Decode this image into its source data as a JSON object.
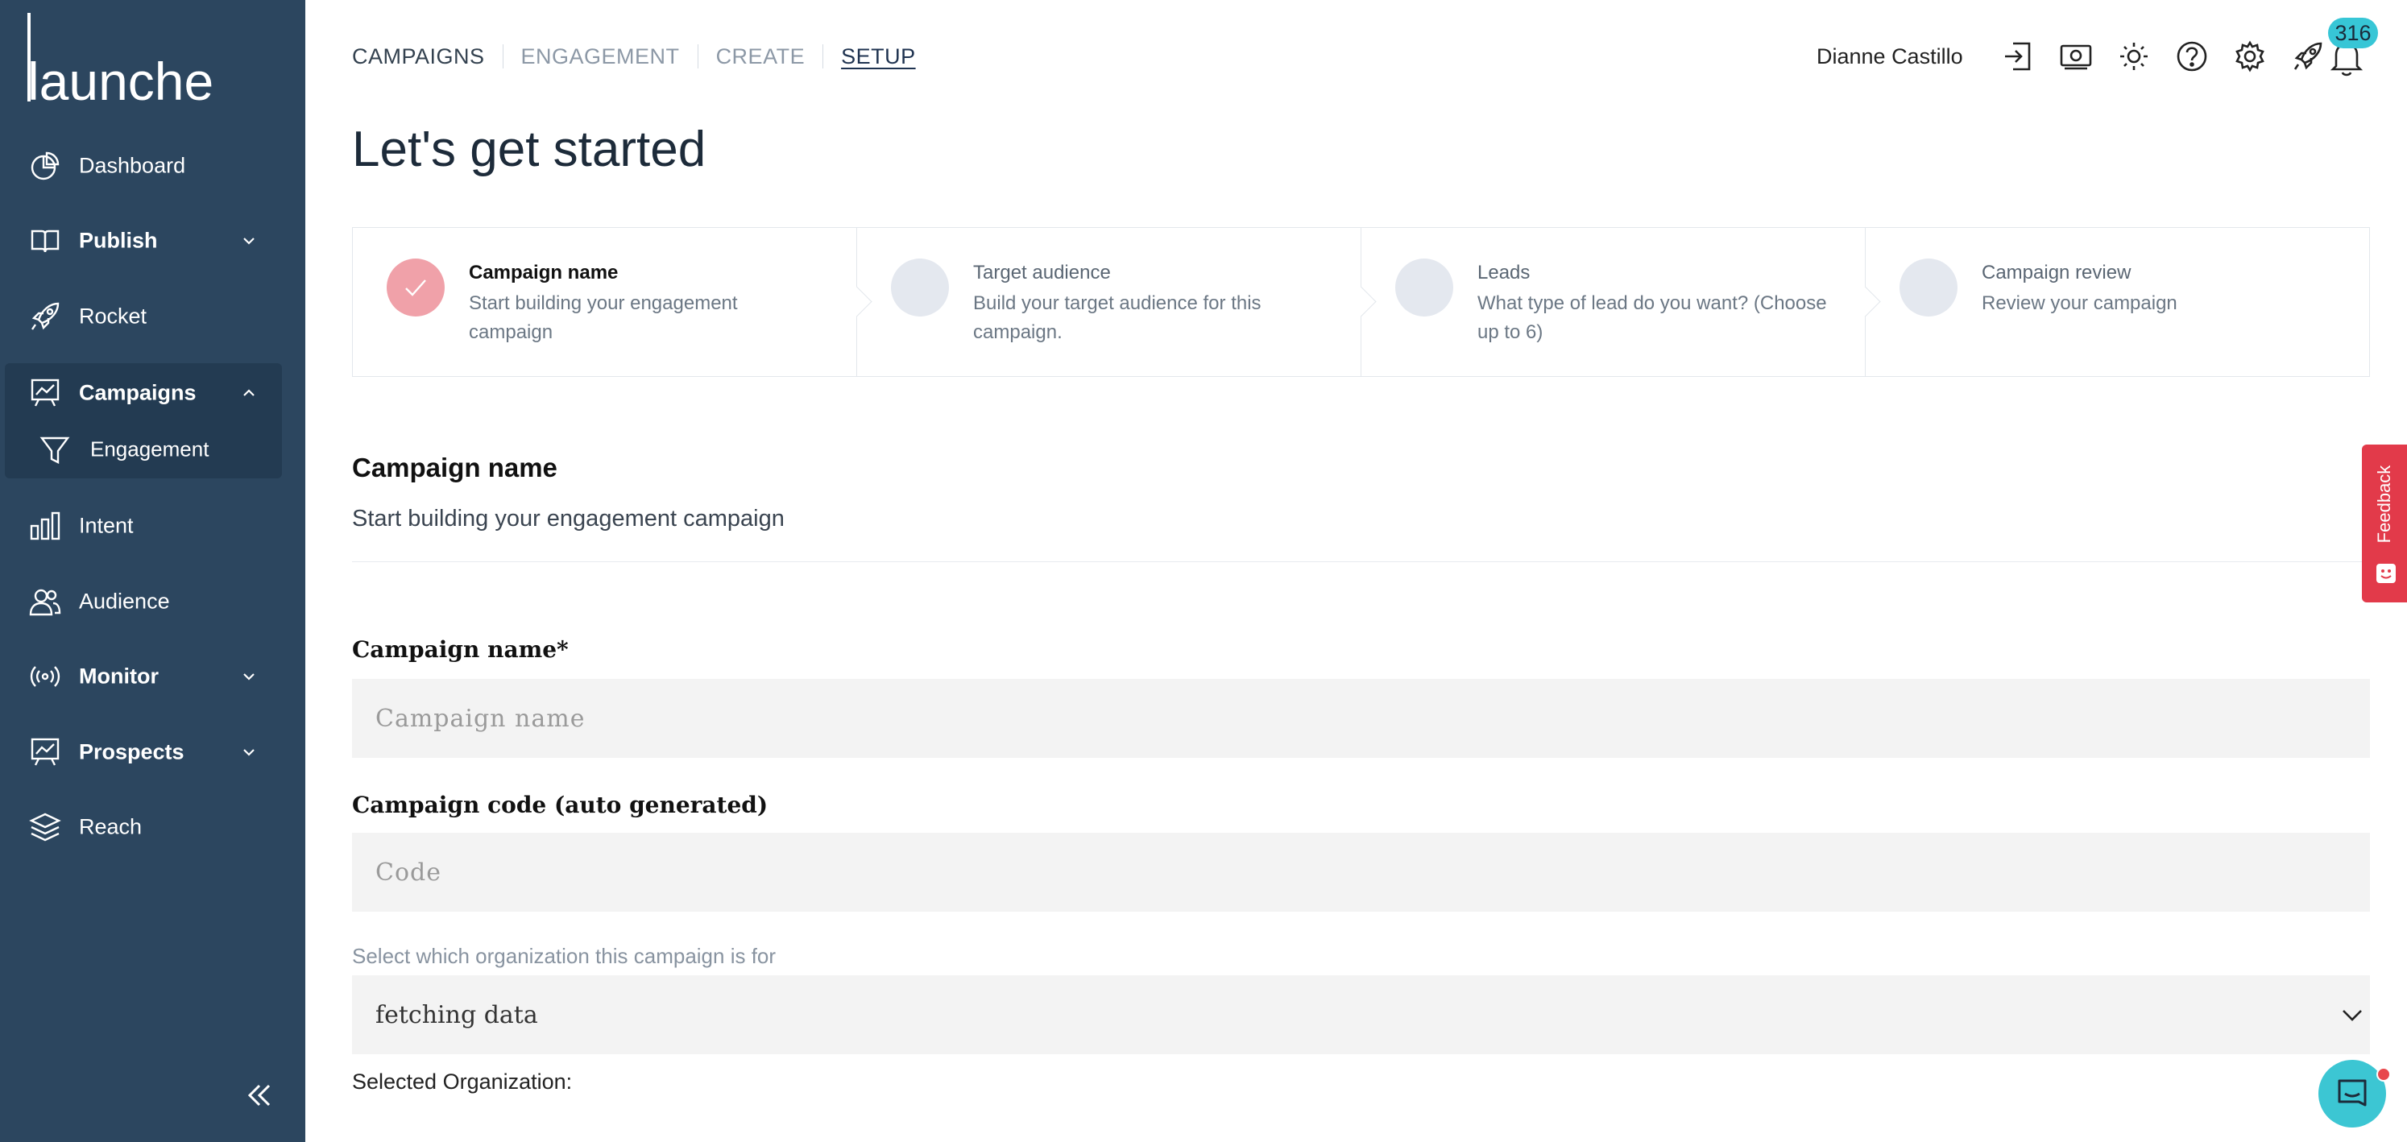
{
  "app": {
    "logo_text": "launched"
  },
  "sidebar": {
    "items": [
      {
        "label": "Dashboard",
        "icon": "dashboard-icon"
      },
      {
        "label": "Publish",
        "icon": "book-icon",
        "expandable": true
      },
      {
        "label": "Rocket",
        "icon": "rocket-icon"
      },
      {
        "label": "Campaigns",
        "icon": "presentation-chart-icon",
        "expanded": true,
        "children": [
          {
            "label": "Engagement",
            "icon": "funnel-icon"
          }
        ]
      },
      {
        "label": "Intent",
        "icon": "bar-chart-icon"
      },
      {
        "label": "Audience",
        "icon": "users-icon"
      },
      {
        "label": "Monitor",
        "icon": "broadcast-icon",
        "expandable": true
      },
      {
        "label": "Prospects",
        "icon": "presentation-chart-icon",
        "expandable": true
      },
      {
        "label": "Reach",
        "icon": "layers-icon"
      }
    ],
    "collapse_icon": "double-chevron-left-icon"
  },
  "topnav": {
    "tabs": [
      {
        "label": "CAMPAIGNS",
        "state": "default"
      },
      {
        "label": "ENGAGEMENT",
        "state": "muted"
      },
      {
        "label": "CREATE",
        "state": "muted"
      },
      {
        "label": "SETUP",
        "state": "active"
      }
    ]
  },
  "user": {
    "name": "Dianne Castillo",
    "icons": [
      "logout-icon",
      "money-icon",
      "sun-icon",
      "help-icon",
      "settings-icon",
      "rocket-icon",
      "bell-icon"
    ],
    "notification_count": "316"
  },
  "page": {
    "title": "Let's get started"
  },
  "stepper": {
    "steps": [
      {
        "title": "Campaign name",
        "description": "Start building your engagement campaign",
        "status": "complete"
      },
      {
        "title": "Target audience",
        "description": "Build your target audience for this campaign.",
        "status": "pending"
      },
      {
        "title": "Leads",
        "description": "What type of lead do you want? (Choose up to 6)",
        "status": "pending"
      },
      {
        "title": "Campaign review",
        "description": "Review your campaign",
        "status": "pending"
      }
    ]
  },
  "section": {
    "title": "Campaign name",
    "subtitle": "Start building your engagement campaign"
  },
  "form": {
    "campaign_name": {
      "label": "Campaign name*",
      "placeholder": "Campaign name",
      "value": ""
    },
    "campaign_code": {
      "label": "Campaign code (auto generated)",
      "placeholder": "Code",
      "value": ""
    },
    "organization": {
      "label": "Select which organization this campaign is for",
      "selected": "fetching data"
    },
    "selected_org_label": "Selected Organization:"
  },
  "feedback": {
    "label": "Feedback"
  },
  "colors": {
    "sidebar_bg": "#2c465f",
    "sidebar_active_bg": "#233b52",
    "accent_teal": "#37c6d6",
    "step_done": "#f0a1a9",
    "feedback_red": "#e23a4a"
  }
}
